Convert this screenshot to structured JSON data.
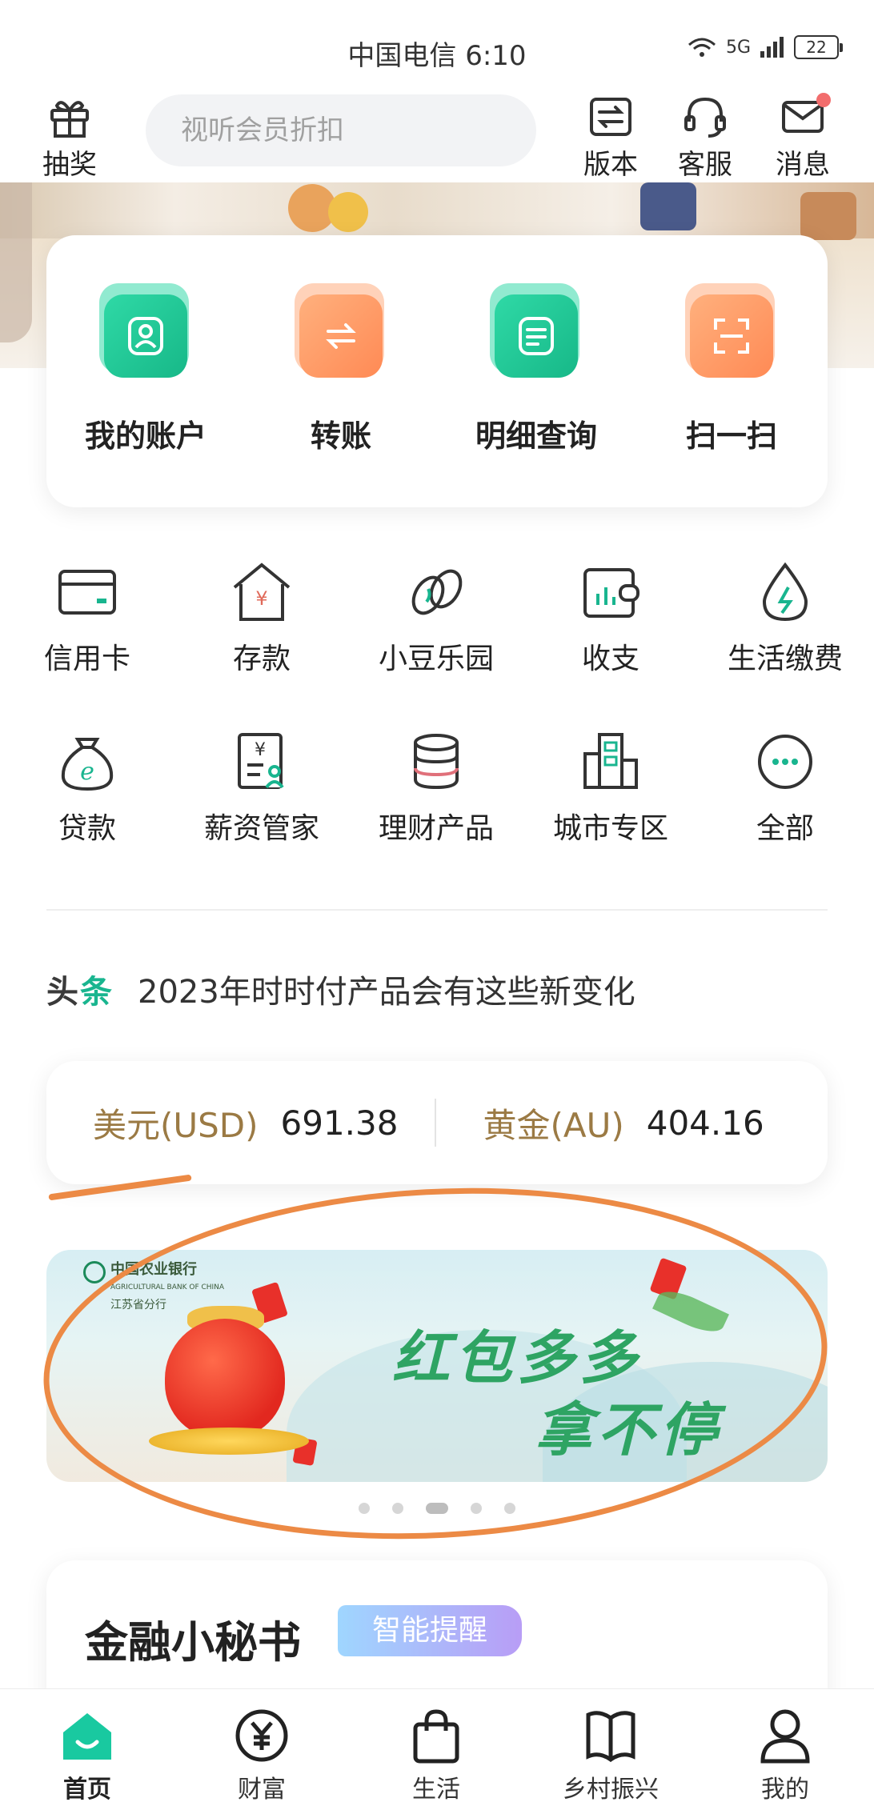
{
  "status_bar": {
    "carrier_time": "中国电信 6:10",
    "signal_labels": "5G",
    "battery": "22"
  },
  "top_nav": {
    "lottery_label": "抽奖",
    "search_placeholder": "视听会员折扣",
    "version_label": "版本",
    "service_label": "客服",
    "message_label": "消息"
  },
  "main_actions": [
    {
      "label": "我的账户",
      "icon": "account-icon"
    },
    {
      "label": "转账",
      "icon": "transfer-icon"
    },
    {
      "label": "明细查询",
      "icon": "statement-icon"
    },
    {
      "label": "扫一扫",
      "icon": "scan-icon"
    }
  ],
  "grid": [
    {
      "label": "信用卡",
      "icon": "credit-card-icon"
    },
    {
      "label": "存款",
      "icon": "deposit-house-icon"
    },
    {
      "label": "小豆乐园",
      "icon": "bean-icon"
    },
    {
      "label": "收支",
      "icon": "wallet-icon"
    },
    {
      "label": "生活缴费",
      "icon": "drop-icon"
    },
    {
      "label": "贷款",
      "icon": "loan-bag-icon"
    },
    {
      "label": "薪资管家",
      "icon": "salary-icon"
    },
    {
      "label": "理财产品",
      "icon": "coin-stack-icon"
    },
    {
      "label": "城市专区",
      "icon": "city-icon"
    },
    {
      "label": "全部",
      "icon": "more-icon"
    }
  ],
  "headline": {
    "tag_a": "头",
    "tag_b": "条",
    "text": "2023年时时付产品会有这些新变化"
  },
  "rates": [
    {
      "name": "美元(USD)",
      "value": "691.38"
    },
    {
      "name": "黄金(AU)",
      "value": "404.16"
    }
  ],
  "banner": {
    "bank_name_cn": "中国农业银行",
    "bank_name_en": "AGRICULTURAL BANK OF CHINA",
    "branch": "江苏省分行",
    "line1": "红包多多",
    "line2": "拿不停",
    "page_count": 5,
    "active_page": 3
  },
  "secretary": {
    "title": "金融小秘书",
    "badge": "智能提醒"
  },
  "tab_bar": [
    {
      "label": "首页",
      "icon": "home-icon",
      "active": true
    },
    {
      "label": "财富",
      "icon": "yuan-icon",
      "active": false
    },
    {
      "label": "生活",
      "icon": "shopping-bag-icon",
      "active": false
    },
    {
      "label": "乡村振兴",
      "icon": "book-icon",
      "active": false
    },
    {
      "label": "我的",
      "icon": "profile-icon",
      "active": false
    }
  ],
  "colors": {
    "brand_green": "#19b58f",
    "accent_orange": "#ff8a55",
    "rate_gold": "#9b7a44",
    "annotation_orange": "#ec8a45"
  }
}
